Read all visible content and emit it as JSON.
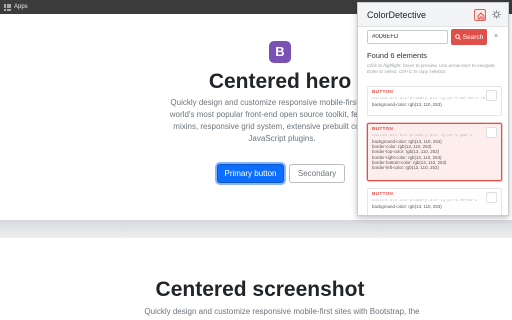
{
  "bookmarks": {
    "apps_label": "Apps"
  },
  "hero": {
    "logo_letter": "B",
    "title": "Centered hero",
    "lead_lines": [
      "Quickly design and customize responsive mobile-first sites with",
      "world’s most popular front-end open source toolkit, featuring Sa",
      "mixins, responsive grid system, extensive prebuilt component",
      "JavaScript plugins."
    ],
    "primary_button": "Primary button",
    "secondary_button": "Secondary"
  },
  "screenshot_section": {
    "title": "Centered screenshot",
    "lead": "Quickly design and customize responsive mobile-first sites with Bootstrap, the"
  },
  "extension": {
    "title": "ColorDetective",
    "search_value": "#0D6EFD",
    "search_button": "Search",
    "clear_label": "×",
    "found_text": "Found 6 elements",
    "hint": "Click to highlight, hover to preview. Use arrow keys to navigate, Enter to select, Ctrl+C to copy selector.",
    "accent_color": "#e0504a",
    "results": [
      {
        "tag": "BUTTON",
        "selector": "button.btn.btn-primary.btn-lg.px-4.me-sm-3.fw-bold",
        "styles": [
          "background-color: rgb(13, 110, 253)"
        ]
      },
      {
        "tag": "BUTTON",
        "selector": "button.btn.btn-primary.btn-lg.px-4.gap-3",
        "styles": [
          "background-color: rgb(13, 110, 253)",
          "border-color: rgb(13, 110, 253)",
          "border-top-color: rgb(13, 110, 253)",
          "border-right-color: rgb(13, 110, 253)",
          "border-bottom-color: rgb(13, 110, 253)",
          "border-left-color: rgb(13, 110, 253)"
        ]
      },
      {
        "tag": "BUTTON",
        "selector": "button.btn.btn-primary.btn-lg.px-4.me-md-2",
        "styles": [
          "background-color: rgb(13, 110, 253)"
        ]
      }
    ]
  }
}
